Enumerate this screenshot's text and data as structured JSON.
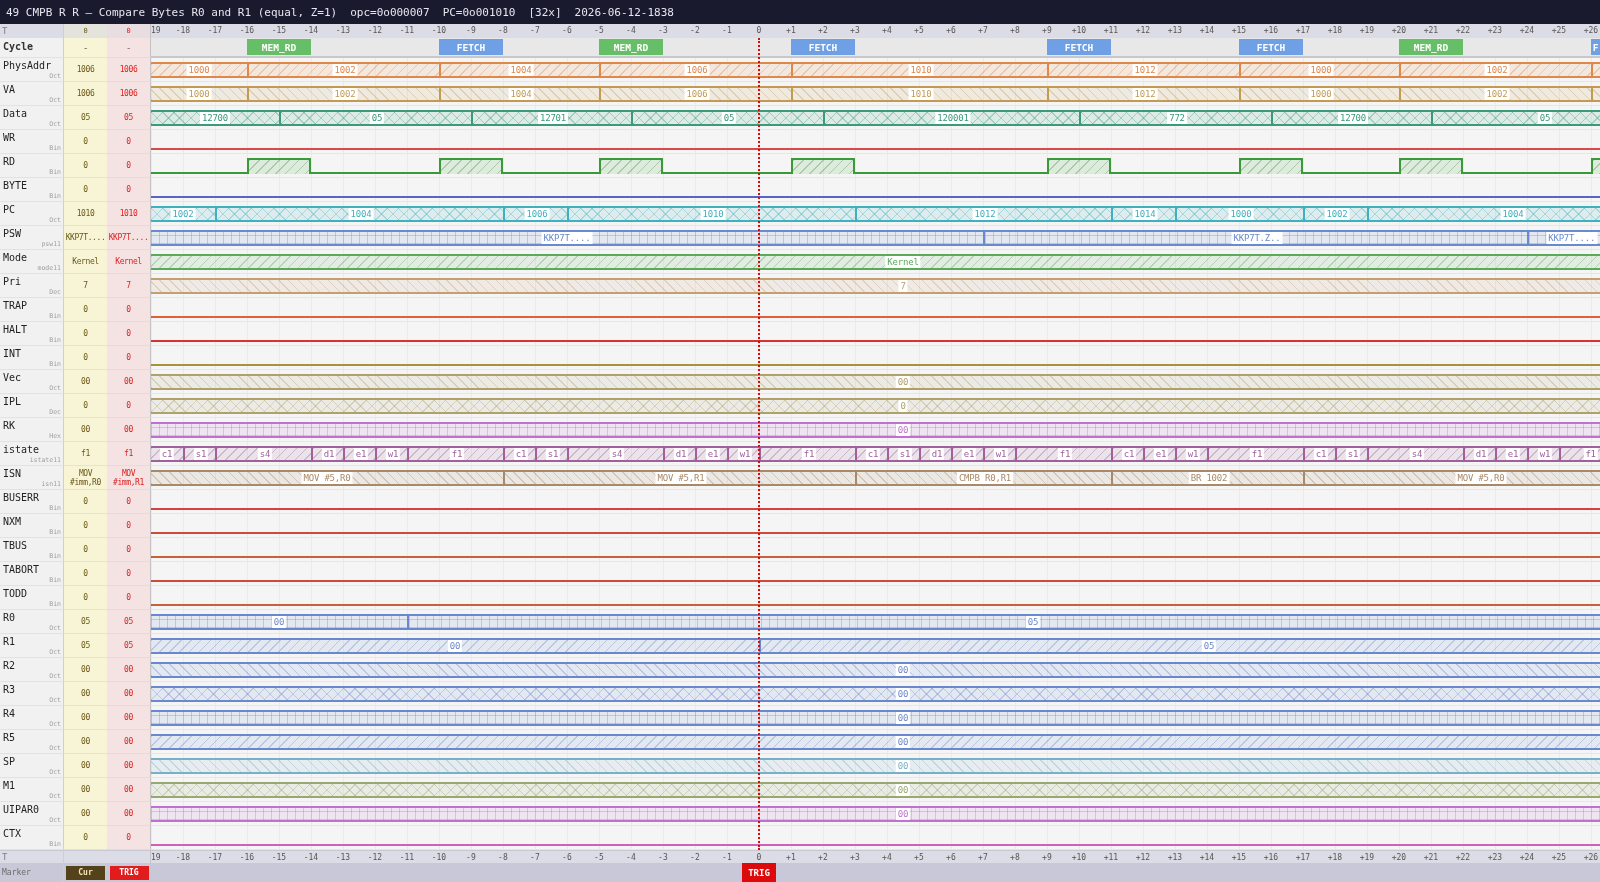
{
  "title_bar": {
    "title": "49 CMPB R R — Compare Bytes R0 and R1 (equal, Z=1)",
    "opcode": "opc=0o000007",
    "pc": "PC=0o001010",
    "zoom": "[32x]",
    "timestamp": "2026-06-12-1838"
  },
  "time_axis_top": {
    "label": "T",
    "cur": "0",
    "trig": "0",
    "ticks": [
      "19",
      "-18",
      "-17",
      "-16",
      "-15",
      "-14",
      "-13",
      "-12",
      "-11",
      "-10",
      "-9",
      "-8",
      "-7",
      "-6",
      "-5",
      "-4",
      "-3",
      "-2",
      "-1",
      "0",
      "+1",
      "+2",
      "+3",
      "+4",
      "+5",
      "+6",
      "+7",
      "+8",
      "+9",
      "+10",
      "+11",
      "+12",
      "+13",
      "+14",
      "+15",
      "+16",
      "+17",
      "+18",
      "+19",
      "+20",
      "+21",
      "+22",
      "+23",
      "+24",
      "+25",
      "+26"
    ]
  },
  "cycle_row": {
    "name": "Cycle",
    "cur": "-",
    "trig": "-",
    "cycles": [
      {
        "label": "MEM_RD",
        "color": "#66bf66"
      },
      {
        "label": "FETCH",
        "color": "#6fa0e6"
      },
      {
        "label": "MEM_RD",
        "color": "#66bf66"
      },
      {
        "label": "FETCH",
        "color": "#6fa0e6"
      },
      {
        "label": "FETCH",
        "color": "#6fa0e6"
      },
      {
        "label": "FETCH",
        "color": "#6fa0e6"
      },
      {
        "label": "MEM_RD",
        "color": "#66bf66"
      },
      {
        "label": "F",
        "color": "#6fa0e6"
      }
    ]
  },
  "signals": [
    {
      "name": "PhysAddr",
      "radix": "Oct",
      "cur": "1006",
      "trig": "1006",
      "kind": "bus",
      "color": "#e0884a",
      "segments": [
        {
          "value": "1000"
        },
        {
          "value": "1002"
        },
        {
          "value": "1004"
        },
        {
          "value": "1006"
        },
        {
          "value": "1010"
        },
        {
          "value": "1012"
        },
        {
          "value": "1000"
        },
        {
          "value": "1002"
        }
      ]
    },
    {
      "name": "VA",
      "radix": "Oct",
      "cur": "1006",
      "trig": "1006",
      "kind": "bus",
      "color": "#c49a52",
      "segments": [
        {
          "value": "1000"
        },
        {
          "value": "1002"
        },
        {
          "value": "1004"
        },
        {
          "value": "1006"
        },
        {
          "value": "1010"
        },
        {
          "value": "1012"
        },
        {
          "value": "1000"
        },
        {
          "value": "1002"
        }
      ]
    },
    {
      "name": "Data",
      "radix": "Oct",
      "cur": "05",
      "trig": "05",
      "kind": "bus",
      "color": "#3a9a7a",
      "segments": [
        {
          "value": "12700"
        },
        {
          "value": "05"
        },
        {
          "value": "12701"
        },
        {
          "value": "05"
        },
        {
          "value": "120001"
        },
        {
          "value": "772"
        },
        {
          "value": "12700"
        },
        {
          "value": "05"
        }
      ]
    },
    {
      "name": "WR",
      "radix": "Bin",
      "cur": "0",
      "trig": "0",
      "kind": "bit",
      "color": "#d84a4a",
      "segments": [
        {
          "high": false
        }
      ]
    },
    {
      "name": "RD",
      "radix": "Bin",
      "cur": "0",
      "trig": "0",
      "kind": "bit",
      "color": "#3a9a3a",
      "segments": [
        {
          "high": false
        },
        {
          "high": true
        },
        {
          "high": false
        },
        {
          "high": true
        },
        {
          "high": false
        },
        {
          "high": true
        },
        {
          "high": false
        },
        {
          "high": true
        },
        {
          "high": false
        },
        {
          "high": true
        },
        {
          "high": false
        },
        {
          "high": true
        },
        {
          "high": false
        },
        {
          "high": true
        },
        {
          "high": false
        },
        {
          "high": true
        }
      ]
    },
    {
      "name": "BYTE",
      "radix": "Bin",
      "cur": "0",
      "trig": "0",
      "kind": "bit",
      "color": "#5a64c8",
      "segments": [
        {
          "high": false
        }
      ]
    },
    {
      "name": "PC",
      "radix": "Oct",
      "cur": "1010",
      "trig": "1010",
      "kind": "bus",
      "color": "#3fb0c0",
      "segments": [
        {
          "value": "1002"
        },
        {
          "value": "1004"
        },
        {
          "value": "1006"
        },
        {
          "value": "1010"
        },
        {
          "value": "1012"
        },
        {
          "value": "1014"
        },
        {
          "value": "1000"
        },
        {
          "value": "1002"
        },
        {
          "value": "1004"
        }
      ]
    },
    {
      "name": "PSW",
      "radix": "psw11",
      "cur": "KKP7T....",
      "trig": "KKP7T....",
      "kind": "bus",
      "color": "#6a8ad0",
      "segments": [
        {
          "value": "KKP7T...."
        },
        {
          "value": "KKP7T.Z.."
        },
        {
          "value": "KKP7T...."
        }
      ]
    },
    {
      "name": "Mode",
      "radix": "mode11",
      "cur": "Kernel",
      "trig": "Kernel",
      "kind": "bus",
      "color": "#5aaa5a",
      "segments": [
        {
          "value": "Kernel"
        }
      ]
    },
    {
      "name": "Pri",
      "radix": "Dec",
      "cur": "7",
      "trig": "7",
      "kind": "bus",
      "color": "#c4a070",
      "segments": [
        {
          "value": "7"
        }
      ]
    },
    {
      "name": "TRAP",
      "radix": "Bin",
      "cur": "0",
      "trig": "0",
      "kind": "bit",
      "color": "#e0603c",
      "segments": [
        {
          "high": false
        }
      ]
    },
    {
      "name": "HALT",
      "radix": "Bin",
      "cur": "0",
      "trig": "0",
      "kind": "bit",
      "color": "#d83232",
      "segments": [
        {
          "high": false
        }
      ]
    },
    {
      "name": "INT",
      "radix": "Bin",
      "cur": "0",
      "trig": "0",
      "kind": "bit",
      "color": "#a8923a",
      "segments": [
        {
          "high": false
        }
      ]
    },
    {
      "name": "Vec",
      "radix": "Oct",
      "cur": "00",
      "trig": "00",
      "kind": "bus",
      "color": "#b0a06a",
      "segments": [
        {
          "value": "00"
        }
      ]
    },
    {
      "name": "IPL",
      "radix": "Dec",
      "cur": "0",
      "trig": "0",
      "kind": "bus",
      "color": "#b0a06a",
      "segments": [
        {
          "value": "0"
        }
      ]
    },
    {
      "name": "RK",
      "radix": "Hex",
      "cur": "00",
      "trig": "00",
      "kind": "bus",
      "color": "#c070d0",
      "segments": [
        {
          "value": "00"
        }
      ]
    },
    {
      "name": "istate",
      "radix": "istate11",
      "cur": "f1",
      "trig": "f1",
      "kind": "bus",
      "color": "#a0609a",
      "segments": [
        {
          "value": "c1"
        },
        {
          "value": "s1"
        },
        {
          "value": "s4"
        },
        {
          "value": "d1"
        },
        {
          "value": "e1"
        },
        {
          "value": "w1"
        },
        {
          "value": "f1"
        },
        {
          "value": "c1"
        },
        {
          "value": "s1"
        },
        {
          "value": "s4"
        },
        {
          "value": "d1"
        },
        {
          "value": "e1"
        },
        {
          "value": "w1"
        },
        {
          "value": "f1"
        },
        {
          "value": "c1"
        },
        {
          "value": "s1"
        },
        {
          "value": "d1"
        },
        {
          "value": "e1"
        },
        {
          "value": "w1"
        },
        {
          "value": "f1"
        },
        {
          "value": "c1"
        },
        {
          "value": "e1"
        },
        {
          "value": "w1"
        },
        {
          "value": "f1"
        },
        {
          "value": "c1"
        },
        {
          "value": "s1"
        },
        {
          "value": "s4"
        },
        {
          "value": "d1"
        },
        {
          "value": "e1"
        },
        {
          "value": "w1"
        },
        {
          "value": "f1"
        }
      ]
    },
    {
      "name": "ISN",
      "radix": "isn11",
      "cur": "MOV #imm,R0",
      "trig": "MOV #imm,R1",
      "kind": "bus",
      "color": "#a88a6a",
      "segments": [
        {
          "value": "MOV #5,R0"
        },
        {
          "value": "MOV #5,R1"
        },
        {
          "value": "CMPB R0,R1"
        },
        {
          "value": "BR 1002"
        },
        {
          "value": "MOV #5,R0"
        }
      ]
    },
    {
      "name": "BUSERR",
      "radix": "Bin",
      "cur": "0",
      "trig": "0",
      "kind": "bit",
      "color": "#d84040",
      "segments": [
        {
          "high": false
        }
      ]
    },
    {
      "name": "NXM",
      "radix": "Bin",
      "cur": "0",
      "trig": "0",
      "kind": "bit",
      "color": "#d04a3a",
      "segments": [
        {
          "high": false
        }
      ]
    },
    {
      "name": "TBUS",
      "radix": "Bin",
      "cur": "0",
      "trig": "0",
      "kind": "bit",
      "color": "#c8603c",
      "segments": [
        {
          "high": false
        }
      ]
    },
    {
      "name": "TABORT",
      "radix": "Bin",
      "cur": "0",
      "trig": "0",
      "kind": "bit",
      "color": "#d04a3a",
      "segments": [
        {
          "high": false
        }
      ]
    },
    {
      "name": "TODD",
      "radix": "Bin",
      "cur": "0",
      "trig": "0",
      "kind": "bit",
      "color": "#c8603c",
      "segments": [
        {
          "high": false
        }
      ]
    },
    {
      "name": "R0",
      "radix": "Oct",
      "cur": "05",
      "trig": "05",
      "kind": "bus",
      "color": "#6a88d0",
      "segments": [
        {
          "value": "00"
        },
        {
          "value": "05"
        }
      ]
    },
    {
      "name": "R1",
      "radix": "Oct",
      "cur": "05",
      "trig": "05",
      "kind": "bus",
      "color": "#6a88d0",
      "segments": [
        {
          "value": "00"
        },
        {
          "value": "05"
        }
      ]
    },
    {
      "name": "R2",
      "radix": "Oct",
      "cur": "00",
      "trig": "00",
      "kind": "bus",
      "color": "#6a88d0",
      "segments": [
        {
          "value": "00"
        }
      ]
    },
    {
      "name": "R3",
      "radix": "Oct",
      "cur": "00",
      "trig": "00",
      "kind": "bus",
      "color": "#6a88d0",
      "segments": [
        {
          "value": "00"
        }
      ]
    },
    {
      "name": "R4",
      "radix": "Oct",
      "cur": "00",
      "trig": "00",
      "kind": "bus",
      "color": "#6a88d0",
      "segments": [
        {
          "value": "00"
        }
      ]
    },
    {
      "name": "R5",
      "radix": "Oct",
      "cur": "00",
      "trig": "00",
      "kind": "bus",
      "color": "#6a88d0",
      "segments": [
        {
          "value": "00"
        }
      ]
    },
    {
      "name": "SP",
      "radix": "Oct",
      "cur": "00",
      "trig": "00",
      "kind": "bus",
      "color": "#78b0c8",
      "segments": [
        {
          "value": "00"
        }
      ]
    },
    {
      "name": "M1",
      "radix": "Oct",
      "cur": "00",
      "trig": "00",
      "kind": "bus",
      "color": "#98a870",
      "segments": [
        {
          "value": "00"
        }
      ]
    },
    {
      "name": "UIPAR0",
      "radix": "Oct",
      "cur": "00",
      "trig": "00",
      "kind": "bus",
      "color": "#c070d0",
      "segments": [
        {
          "value": "00"
        }
      ]
    },
    {
      "name": "CTX",
      "radix": "Bin",
      "cur": "0",
      "trig": "0",
      "kind": "bit",
      "color": "#d060b8",
      "segments": [
        {
          "high": false
        }
      ]
    }
  ],
  "time_axis_bottom": {
    "label": "T",
    "ticks": [
      "19",
      "-18",
      "-17",
      "-16",
      "-15",
      "-14",
      "-13",
      "-12",
      "-11",
      "-10",
      "-9",
      "-8",
      "-7",
      "-6",
      "-5",
      "-4",
      "-3",
      "-2",
      "-1",
      "0",
      "+1",
      "+2",
      "+3",
      "+4",
      "+5",
      "+6",
      "+7",
      "+8",
      "+9",
      "+10",
      "+11",
      "+12",
      "+13",
      "+14",
      "+15",
      "+16",
      "+17",
      "+18",
      "+19",
      "+20",
      "+21",
      "+22",
      "+23",
      "+24",
      "+25",
      "+26"
    ]
  },
  "marker_bar": {
    "label": "Marker",
    "buttons": [
      {
        "label": "Cur",
        "color": "#54431a"
      },
      {
        "label": "TRIG",
        "color": "#e01c1c"
      }
    ],
    "markers": [
      {
        "label": "TRIG",
        "color": "#dc0a0a"
      }
    ]
  }
}
